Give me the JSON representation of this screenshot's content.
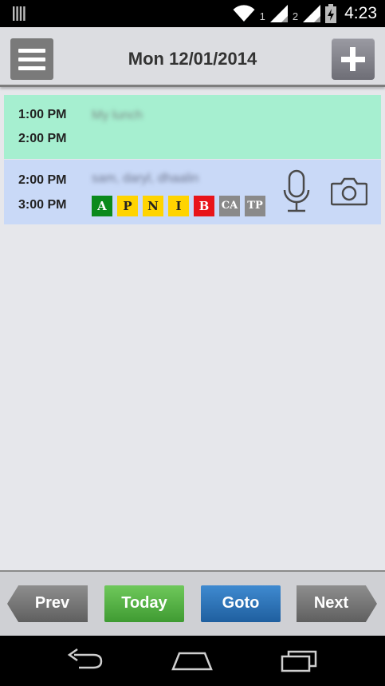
{
  "status_bar": {
    "sim1_label": "1",
    "sim2_label": "2",
    "time": "4:23",
    "icons": [
      "sim-card-icon",
      "wifi-icon",
      "signal-icon",
      "battery-charging-icon"
    ]
  },
  "header": {
    "date": "Mon 12/01/2014",
    "menu_icon": "menu-icon",
    "add_icon": "plus-icon"
  },
  "events": [
    {
      "start": "1:00 PM",
      "end": "2:00 PM",
      "title": "My lunch",
      "color": "#a6efd0"
    },
    {
      "start": "2:00 PM",
      "end": "3:00 PM",
      "title": "sam, daryl, dhaalin",
      "color": "#c9d9f7",
      "badges": [
        {
          "label": "A",
          "bg": "#0b8a1c",
          "fg": "#ffffff"
        },
        {
          "label": "P",
          "bg": "#ffd400",
          "fg": "#222222"
        },
        {
          "label": "N",
          "bg": "#ffd400",
          "fg": "#222222"
        },
        {
          "label": "I",
          "bg": "#ffd400",
          "fg": "#222222"
        },
        {
          "label": "B",
          "bg": "#e8141a",
          "fg": "#ffffff"
        },
        {
          "label": "CA",
          "bg": "#8a8a8a",
          "fg": "#ffffff"
        },
        {
          "label": "TP",
          "bg": "#8a8a8a",
          "fg": "#ffffff"
        }
      ],
      "icons": [
        "microphone-icon",
        "camera-icon"
      ]
    }
  ],
  "nav": {
    "prev": "Prev",
    "today": "Today",
    "goto": "Goto",
    "next": "Next"
  },
  "system_nav": {
    "icons": [
      "back-icon",
      "home-icon",
      "recent-apps-icon"
    ]
  }
}
